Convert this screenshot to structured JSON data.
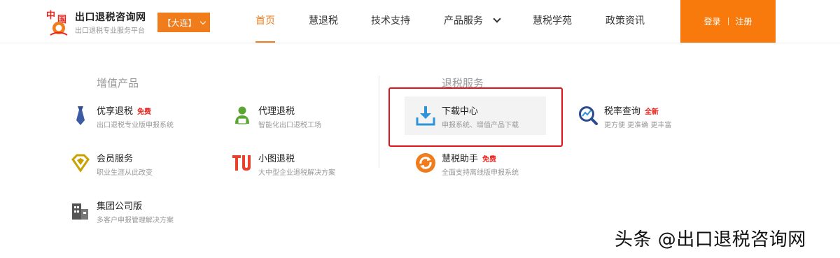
{
  "brand": {
    "logo_text": "中国",
    "name": "出口退税咨询网",
    "subtitle": "出口退税专业服务平台",
    "city": "【大连】"
  },
  "nav": {
    "items": [
      {
        "label": "首页",
        "active": true
      },
      {
        "label": "慧退税"
      },
      {
        "label": "技术支持"
      },
      {
        "label": "产品服务",
        "has_dropdown": true
      },
      {
        "label": "慧税学苑"
      },
      {
        "label": "政策资讯"
      }
    ]
  },
  "auth": {
    "login": "登录",
    "register": "注册"
  },
  "sections": {
    "value_added": {
      "title": "增值产品",
      "items": [
        {
          "title": "优享退税",
          "tag": "免费",
          "desc": "出口退税专业版申报系统",
          "icon": "tie-icon"
        },
        {
          "title": "代理退税",
          "desc": "智能化出口退税工场",
          "icon": "agent-icon"
        },
        {
          "title": "会员服务",
          "desc": "职业生涯从此改变",
          "icon": "diamond-badge-icon"
        },
        {
          "title": "小图退税",
          "desc": "大中型企业退税解决方案",
          "icon": "tu-logo-icon"
        },
        {
          "title": "集团公司版",
          "desc": "多客户申报管理解决方案",
          "icon": "building-icon"
        }
      ]
    },
    "refund": {
      "title": "退税服务",
      "items": [
        {
          "title": "下载中心",
          "desc": "申报系统、增值产品下载",
          "icon": "download-icon",
          "highlighted": true
        },
        {
          "title": "税率查询",
          "tag": "全新",
          "desc": "更方便 更准确 更丰富",
          "icon": "chart-search-icon"
        },
        {
          "title": "慧税助手",
          "tag": "免费",
          "desc": "全面支持离线版申报系统",
          "icon": "sync-icon"
        }
      ]
    }
  },
  "watermark": "头条 @出口退税咨询网",
  "colors": {
    "accent": "#f07c1b",
    "tag_red": "#e8231c",
    "highlight_border": "#e0141b"
  }
}
